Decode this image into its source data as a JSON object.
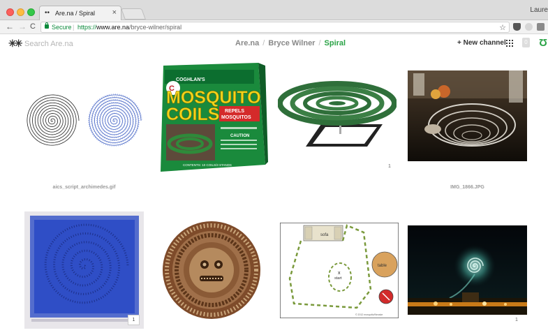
{
  "browser": {
    "tab_icon": "••",
    "tab_title": "Are.na / Spiral",
    "tab_close": "×",
    "user": "Laure",
    "nav": {
      "back": "←",
      "forward": "→",
      "reload": "C"
    },
    "omnibox": {
      "secure_label": "Secure",
      "separator": "|",
      "scheme": "https://",
      "host": "www.are.na",
      "path": "/bryce-wilner/spiral"
    },
    "star": "☆",
    "more": "⋮",
    "colors": {
      "secure": "#0b8a3b",
      "chrome": "#dcdcdc"
    }
  },
  "site": {
    "logo": "✳✳",
    "search_placeholder": "Search Are.na",
    "breadcrumb": [
      "Are.na",
      "Bryce Wilner",
      "Spiral"
    ],
    "breadcrumb_separator": "/",
    "new_channel_label": "+ New channel",
    "notification_count": "0",
    "accent_color": "#2aa346"
  },
  "blocks": [
    {
      "caption": "aics_script_archimedes.gif",
      "connections": ""
    },
    {
      "caption": "",
      "connections": ""
    },
    {
      "caption": "",
      "connections": "1"
    },
    {
      "caption": "IMG_1866.JPG",
      "connections": ""
    },
    {
      "caption": "",
      "connections": "1"
    },
    {
      "caption": "",
      "connections": ""
    },
    {
      "caption": "",
      "connections": ""
    },
    {
      "caption": "",
      "connections": "1"
    }
  ],
  "images": {
    "mosquito_box": {
      "brand": "COGHLAN'S",
      "title_line1": "MOSQUITO",
      "title_line2": "COILS",
      "banner_line1": "REPELS",
      "banner_line2": "MOSQUITOS",
      "caution": "CAUTION",
      "contents": "CONTENTS: 10 COILS/3 STANDS"
    },
    "floor_plan": {
      "sofa_label": "sofa",
      "table_label": "table",
      "start_label": "start",
      "start_mark": "x",
      "credit": "© 2012 mosquito/Neoske"
    }
  }
}
